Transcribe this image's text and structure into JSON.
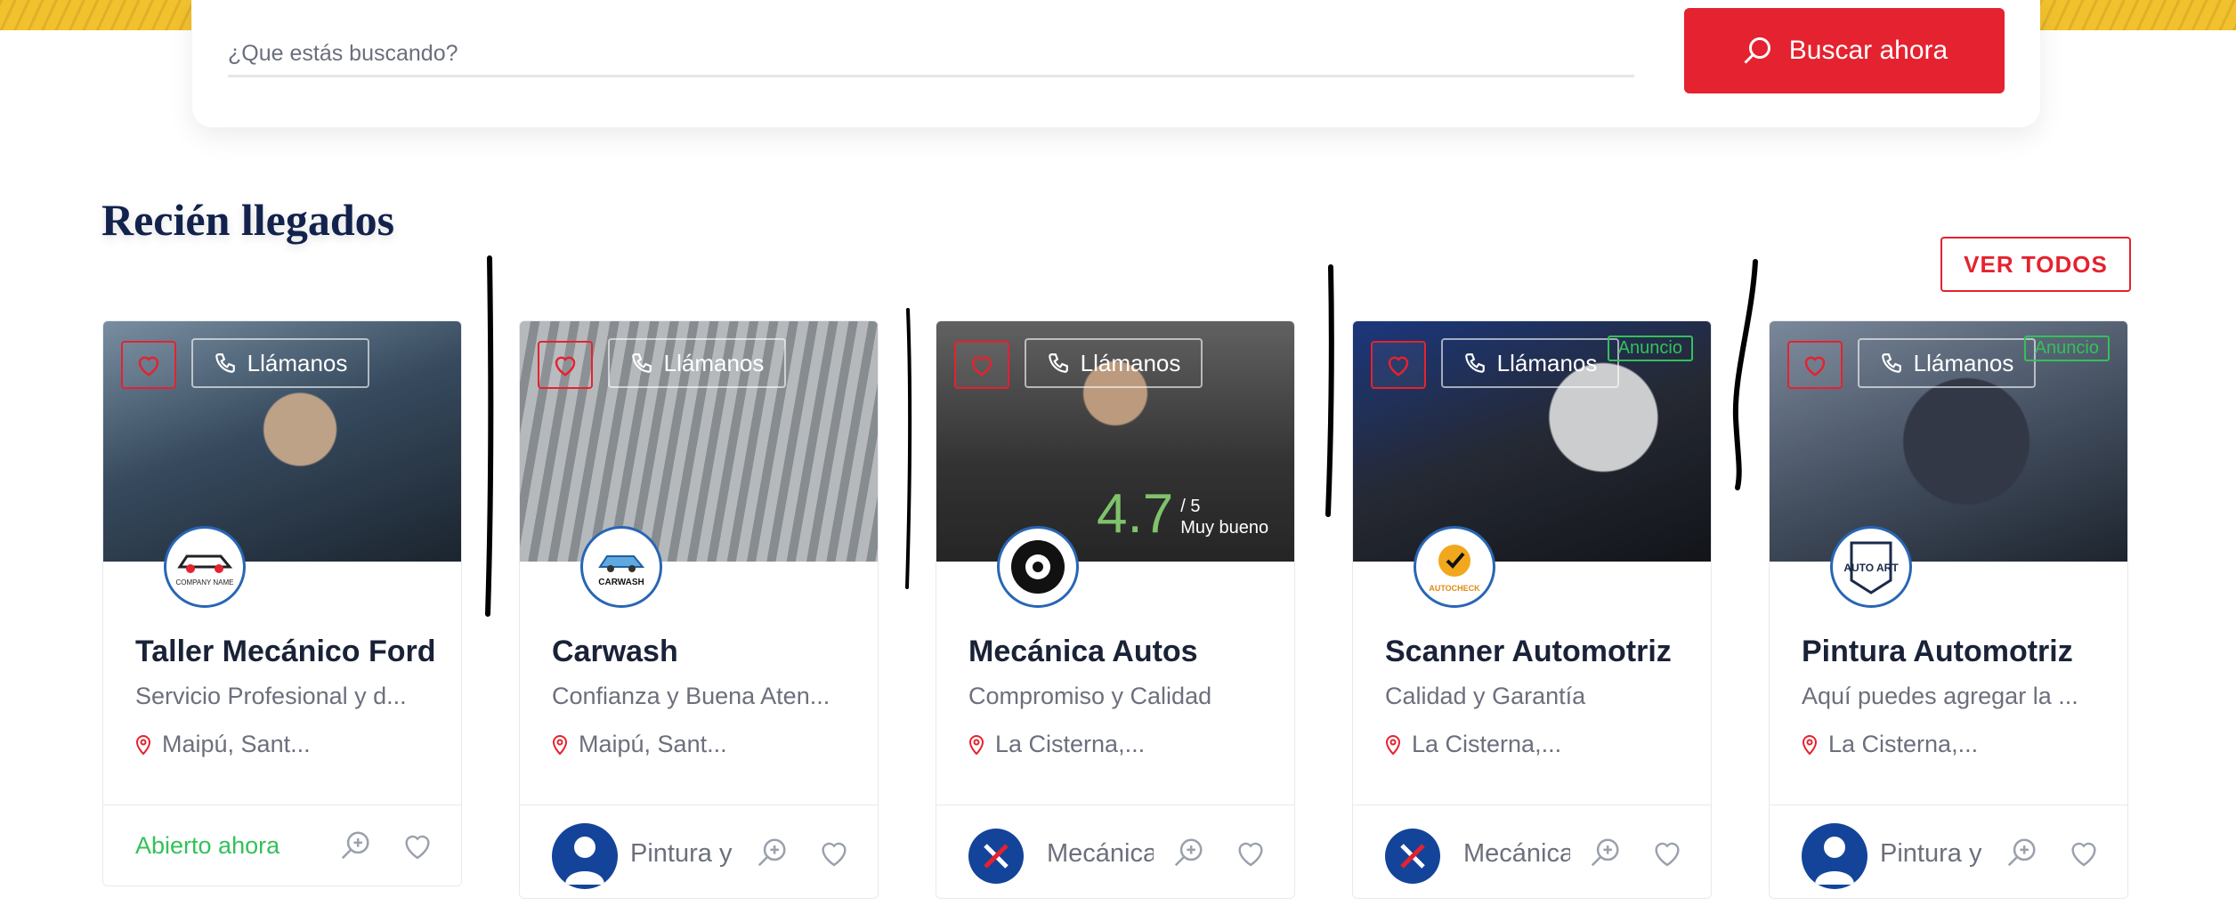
{
  "search": {
    "placeholder": "¿Que estás buscando?",
    "button_label": "Buscar ahora"
  },
  "section": {
    "title": "Recién llegados",
    "view_all_label": "VER TODOS"
  },
  "listings": [
    {
      "title": "Taller Mecánico Ford",
      "subtitle": "Servicio Profesional y d...",
      "location": "Maipú, Sant...",
      "call_label": "Llámanos",
      "status": "Abierto ahora",
      "logo_text": "COMPANY NAME"
    },
    {
      "title": "Carwash",
      "subtitle": "Confianza y Buena Aten...",
      "location": "Maipú, Sant...",
      "call_label": "Llámanos",
      "author": "Pintura y",
      "logo_text": "CARWASH"
    },
    {
      "title": "Mecánica Autos",
      "subtitle": "Compromiso y Calidad",
      "location": "La Cisterna,...",
      "call_label": "Llámanos",
      "author": "Mecánica",
      "rating": "4.7",
      "rating_max": "/ 5",
      "rating_text": "Muy bueno"
    },
    {
      "title": "Scanner Automotriz",
      "subtitle": "Calidad y Garantía",
      "location": "La Cisterna,...",
      "call_label": "Llámanos",
      "author": "Mecánica",
      "ad_label": "Anuncio",
      "logo_text": "AUTOCHECK"
    },
    {
      "title": "Pintura Automotriz",
      "subtitle": "Aquí puedes agregar la ...",
      "location": "La Cisterna,...",
      "call_label": "Llámanos",
      "author": "Pintura y",
      "ad_label": "Anuncio",
      "logo_text": "AUTO ART"
    }
  ],
  "colors": {
    "accent": "#e5222f",
    "navy": "#13224d",
    "open": "#34c159",
    "logo_ring": "#2866b4"
  }
}
